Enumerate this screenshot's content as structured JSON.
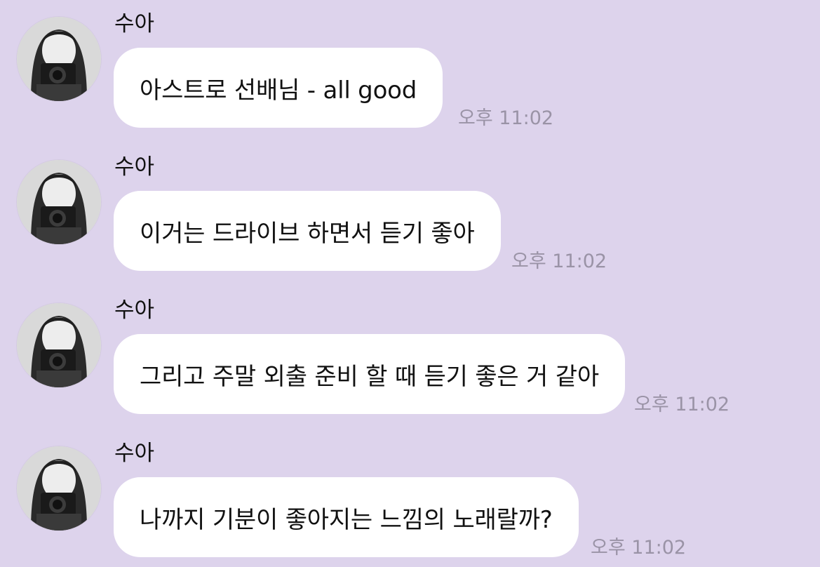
{
  "messages": [
    {
      "sender": "수아",
      "text": "아스트로 선배님 - all good",
      "time": "오후 11:02"
    },
    {
      "sender": "수아",
      "text": "이거는 드라이브 하면서 듣기 좋아",
      "time": "오후 11:02"
    },
    {
      "sender": "수아",
      "text": "그리고 주말 외출 준비 할 때 듣기 좋은 거 같아",
      "time": "오후 11:02"
    },
    {
      "sender": "수아",
      "text": "나까지 기분이 좋아지는 느낌의 노래랄까?",
      "time": "오후 11:02"
    }
  ],
  "colors": {
    "background": "#ddd3ec",
    "bubble": "#ffffff",
    "timestamp": "#9a93a6"
  },
  "icons": {
    "avatar": "profile-photo"
  }
}
